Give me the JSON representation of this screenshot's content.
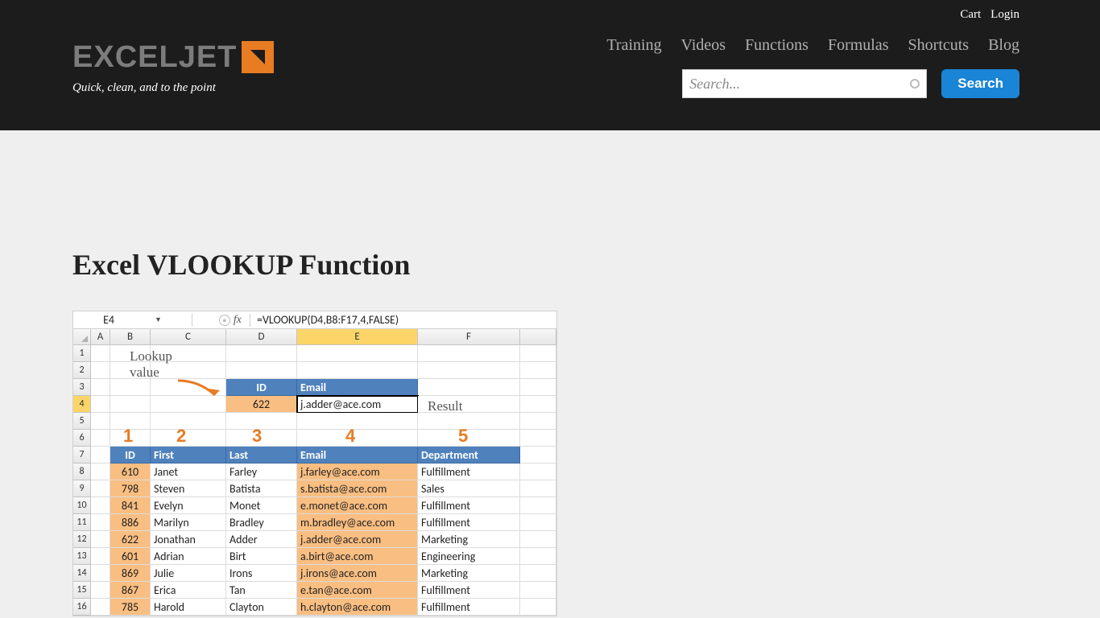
{
  "topbar": {
    "cart": "Cart",
    "login": "Login"
  },
  "logo": {
    "text": "EXCELJET",
    "slogan": "Quick, clean, and to the point"
  },
  "nav": [
    "Training",
    "Videos",
    "Functions",
    "Formulas",
    "Shortcuts",
    "Blog"
  ],
  "search": {
    "placeholder": "Search...",
    "button": "Search"
  },
  "page": {
    "title": "Excel VLOOKUP Function"
  },
  "excel": {
    "active_cell": "E4",
    "formula": "=VLOOKUP(D4,B8:F17,4,FALSE)",
    "cols": [
      "A",
      "B",
      "C",
      "D",
      "E",
      "F"
    ],
    "lookup_headers": [
      "ID",
      "Email"
    ],
    "lookup_row": {
      "id": "622",
      "email": "j.adder@ace.com"
    },
    "annot": {
      "lookup": "Lookup\nvalue",
      "result": "Result"
    },
    "col_nums": [
      "1",
      "2",
      "3",
      "4",
      "5"
    ],
    "table_headers": [
      "ID",
      "First",
      "Last",
      "Email",
      "Department"
    ],
    "rows": [
      {
        "id": "610",
        "first": "Janet",
        "last": "Farley",
        "email": "j.farley@ace.com",
        "dept": "Fulfillment"
      },
      {
        "id": "798",
        "first": "Steven",
        "last": "Batista",
        "email": "s.batista@ace.com",
        "dept": "Sales"
      },
      {
        "id": "841",
        "first": "Evelyn",
        "last": "Monet",
        "email": "e.monet@ace.com",
        "dept": "Fulfillment"
      },
      {
        "id": "886",
        "first": "Marilyn",
        "last": "Bradley",
        "email": "m.bradley@ace.com",
        "dept": "Fulfillment"
      },
      {
        "id": "622",
        "first": "Jonathan",
        "last": "Adder",
        "email": "j.adder@ace.com",
        "dept": "Marketing"
      },
      {
        "id": "601",
        "first": "Adrian",
        "last": "Birt",
        "email": "a.birt@ace.com",
        "dept": "Engineering"
      },
      {
        "id": "869",
        "first": "Julie",
        "last": "Irons",
        "email": "j.irons@ace.com",
        "dept": "Marketing"
      },
      {
        "id": "867",
        "first": "Erica",
        "last": "Tan",
        "email": "e.tan@ace.com",
        "dept": "Fulfillment"
      },
      {
        "id": "785",
        "first": "Harold",
        "last": "Clayton",
        "email": "h.clayton@ace.com",
        "dept": "Fulfillment"
      }
    ]
  }
}
